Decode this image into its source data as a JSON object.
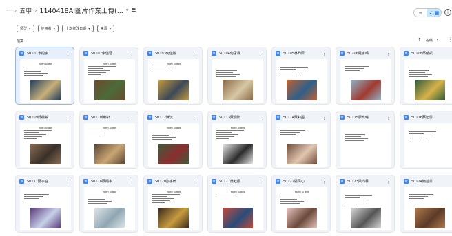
{
  "header": {
    "nav_dash": "—",
    "nav_chevron": "›",
    "breadcrumb": [
      "五甲",
      "1140418AI圖片作業上傳(..."
    ],
    "dropdown_icon": "chevron-down-icon",
    "share_icon": "people-icon"
  },
  "view_toggle": {
    "list_icon": "≡",
    "grid_icon": "✓ ▦"
  },
  "info_icon_char": "ⓘ",
  "filters": [
    {
      "label": "類型"
    },
    {
      "label": "使用者"
    },
    {
      "label": "上次修改日期"
    },
    {
      "label": "來源"
    }
  ],
  "files_section": {
    "label": "檔案",
    "sort_label": "名稱",
    "sort_arrow": "↑",
    "more": "⋮"
  },
  "files": [
    {
      "name": "50101李柏宇",
      "doc_title": "Mperi AI 服務",
      "img_a": "#1f3d5c",
      "img_b": "#c8b07a"
    },
    {
      "name": "50102余佳蓉",
      "doc_title": "Mperi AI 服務",
      "img_a": "#6b4a2b",
      "img_b": "#4c6b3a"
    },
    {
      "name": "50103何佳融",
      "doc_title": "Mperi AI 服務",
      "img_a": "#c39a3d",
      "img_b": "#3b4a57"
    },
    {
      "name": "50104何思霖",
      "doc_title": "",
      "img_a": "#8a6a45",
      "img_b": "#d7c7a5"
    },
    {
      "name": "50105林昀辰",
      "doc_title": "",
      "img_a": "#c2612e",
      "img_b": "#2f5f8a"
    },
    {
      "name": "50106羅宇晴",
      "doc_title": "",
      "img_a": "#8fb3c9",
      "img_b": "#a03a2f"
    },
    {
      "name": "50108邱郁凱",
      "doc_title": "",
      "img_a": "#2d5a3a",
      "img_b": "#d6b24a"
    },
    {
      "name": "50109邱薇蓁",
      "doc_title": "Mperi AI 服務",
      "img_a": "#8a6d52",
      "img_b": "#3a3029"
    },
    {
      "name": "50110陳緯仁",
      "doc_title": "Mperi AI 服務",
      "img_a": "#5a4633",
      "img_b": "#c9a574"
    },
    {
      "name": "50112陳沅",
      "doc_title": "Mperi AI 服務",
      "img_a": "#3f5b3b",
      "img_b": "#8b2e2e"
    },
    {
      "name": "50113黃湧煦",
      "doc_title": "Mperi AI 服務",
      "img_a": "#e9e9e9",
      "img_b": "#2c2c2c"
    },
    {
      "name": "50114黃莉語",
      "doc_title": "",
      "img_a": "#6e4a3a",
      "img_b": "#e0c7b0"
    },
    {
      "name": "50115廖允晞",
      "doc_title": "",
      "img_a": "#ffffff",
      "img_b": "#ffffff"
    },
    {
      "name": "50116蔡旭恩",
      "doc_title": "",
      "img_a": "#ffffff",
      "img_b": "#ffffff"
    },
    {
      "name": "50117鄭宇庭",
      "doc_title": "",
      "img_a": "#5a3a7a",
      "img_b": "#c7d1e8"
    },
    {
      "name": "50118蔡翔宇",
      "doc_title": "Mperi AI 服務",
      "img_a": "#dfe6ea",
      "img_b": "#8fa6b2"
    },
    {
      "name": "50120劉宇綺",
      "doc_title": "Mperi AI 服務",
      "img_a": "#3a2a1c",
      "img_b": "#c79b3e"
    },
    {
      "name": "50121蕭鈺翔",
      "doc_title": "Mperi AI 服務",
      "img_a": "#c24a3a",
      "img_b": "#2a4d7a"
    },
    {
      "name": "50122嚴倩心",
      "doc_title": "Mperi AI 服務",
      "img_a": "#e8c4c0",
      "img_b": "#6a4a3a"
    },
    {
      "name": "50123梁均霖",
      "doc_title": "",
      "img_a": "#d9d9d9",
      "img_b": "#555555"
    },
    {
      "name": "50124簡芸茶",
      "doc_title": "",
      "img_a": "#b07a4e",
      "img_b": "#5a3a26"
    }
  ]
}
